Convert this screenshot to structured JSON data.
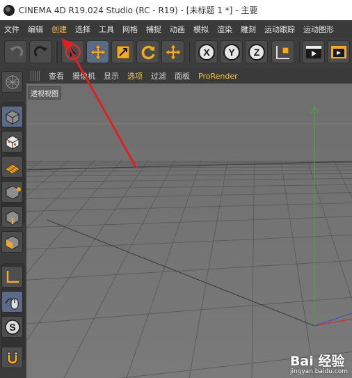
{
  "window": {
    "title": "CINEMA 4D R19.024 Studio (RC - R19) - [未标题 1 *] - 主要"
  },
  "menu": [
    {
      "label": "文件",
      "highlight": false
    },
    {
      "label": "编辑",
      "highlight": false
    },
    {
      "label": "创建",
      "highlight": true
    },
    {
      "label": "选择",
      "highlight": false
    },
    {
      "label": "工具",
      "highlight": false
    },
    {
      "label": "网格",
      "highlight": false
    },
    {
      "label": "捕捉",
      "highlight": false
    },
    {
      "label": "动画",
      "highlight": false
    },
    {
      "label": "模拟",
      "highlight": false
    },
    {
      "label": "渲染",
      "highlight": false
    },
    {
      "label": "雕刻",
      "highlight": false
    },
    {
      "label": "运动跟踪",
      "highlight": false
    },
    {
      "label": "运动图形",
      "highlight": false
    }
  ],
  "viewport_menu": [
    {
      "label": "查看",
      "highlight": false
    },
    {
      "label": "摄像机",
      "highlight": false
    },
    {
      "label": "显示",
      "highlight": false
    },
    {
      "label": "选项",
      "highlight": true
    },
    {
      "label": "过滤",
      "highlight": false
    },
    {
      "label": "面板",
      "highlight": false
    },
    {
      "label": "ProRender",
      "highlight": true
    }
  ],
  "viewport": {
    "label": "透视视图"
  },
  "toolbar_icons": [
    "undo-icon",
    "redo-icon",
    "live-selection-icon",
    "move-icon",
    "scale-icon",
    "rotate-icon",
    "recent-tools-icon",
    "x-axis-lock-icon",
    "y-axis-lock-icon",
    "z-axis-lock-icon",
    "coordinate-system-icon",
    "render-view-icon",
    "render-picture-viewer-icon"
  ],
  "left_icons": [
    "make-editable-icon",
    "model-mode-icon",
    "texture-mode-icon",
    "workplane-mode-icon",
    "points-mode-icon",
    "edges-mode-icon",
    "polygons-mode-icon",
    "axis-mode-icon",
    "tweak-mode-icon",
    "snap-icon",
    "magnet-icon"
  ],
  "watermark": {
    "brand": "Bai 经验",
    "url": "jingyan.baidu.com"
  },
  "colors": {
    "menu_highlight": "#f2c34a",
    "annotation_arrow": "#e02020",
    "y_axis": "#3fa83f",
    "x_axis": "#c83232",
    "z_axis": "#3a4fc8",
    "active_button": "#5a6b88"
  }
}
